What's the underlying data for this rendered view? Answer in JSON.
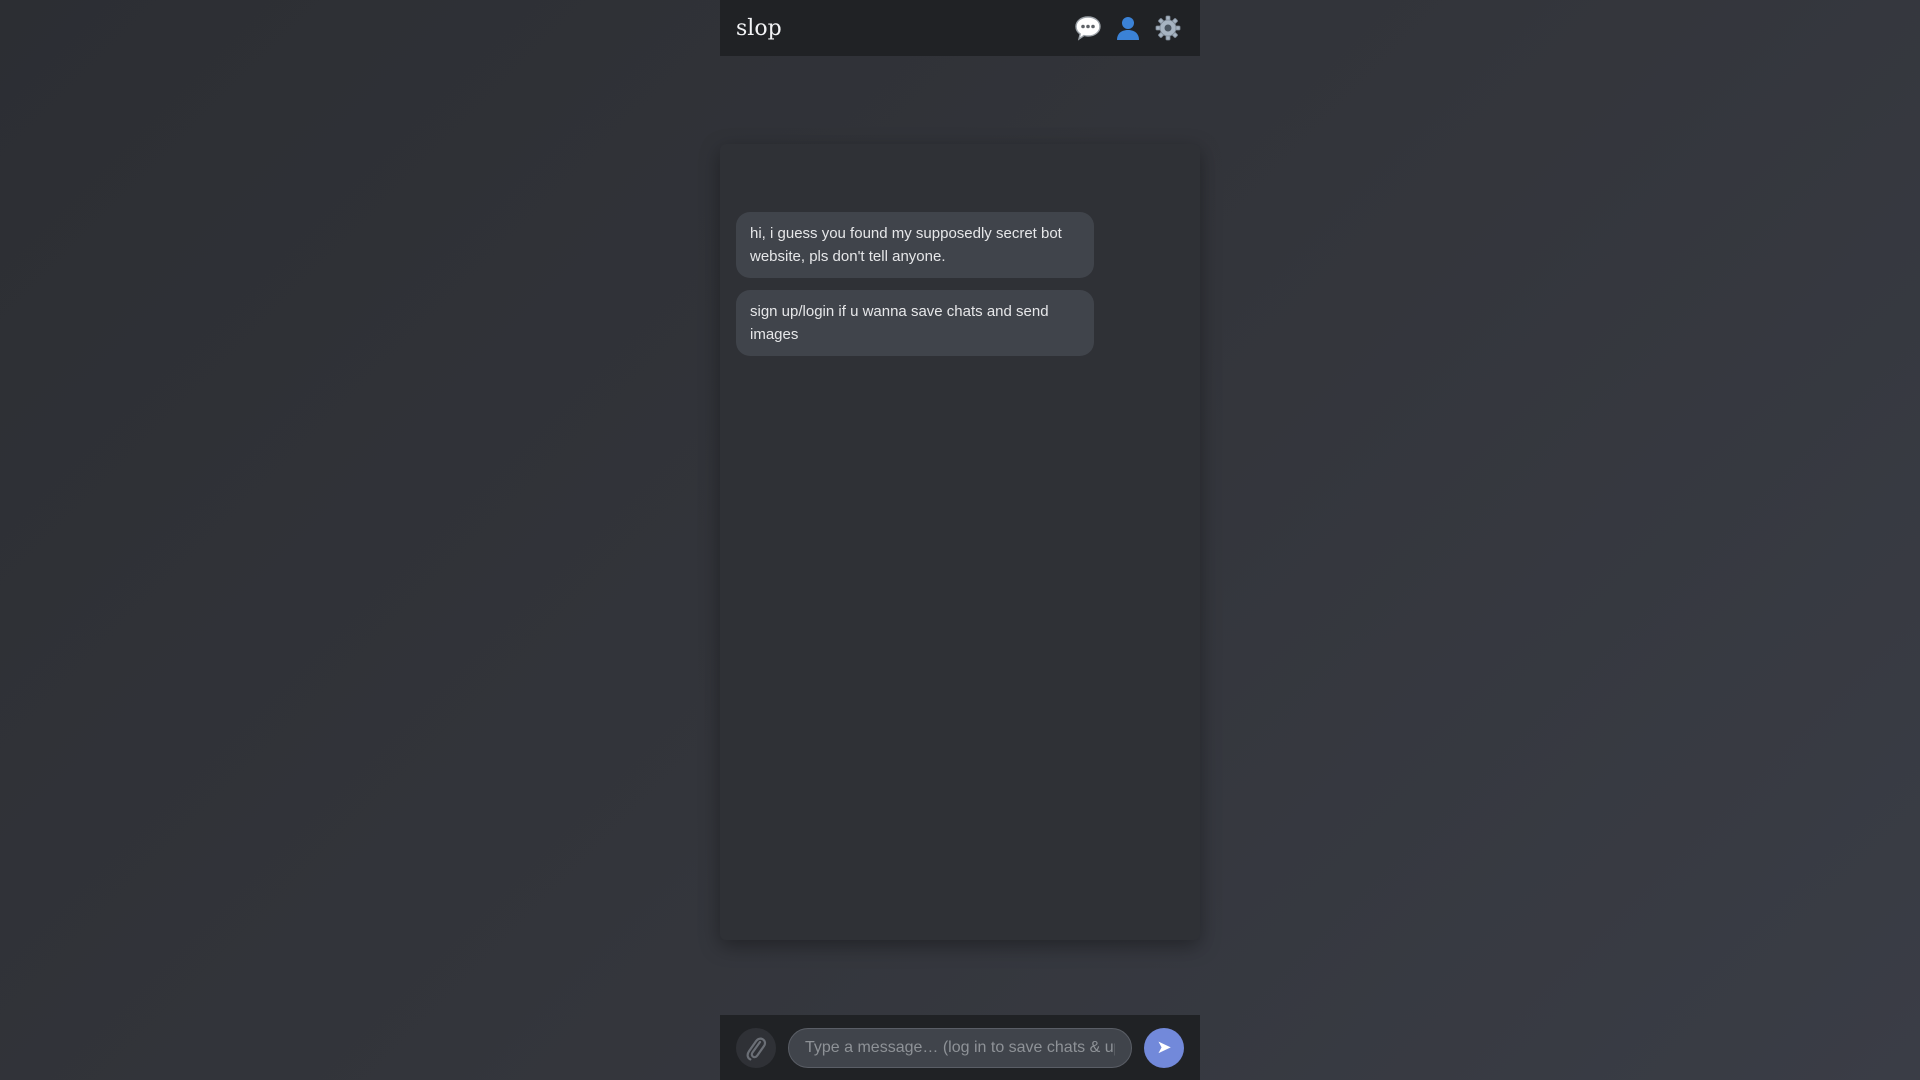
{
  "header": {
    "brand": "slop",
    "icons": [
      "chat-bubble-icon",
      "user-icon",
      "gear-icon"
    ]
  },
  "messages": [
    {
      "text": "hi, i guess you found my supposedly secret bot website, pls don't tell anyone."
    },
    {
      "text": "sign up/login if u wanna save chats and send images"
    }
  ],
  "composer": {
    "placeholder": "Type a message… (log in to save chats & upload images)",
    "value": "",
    "attach_icon": "paperclip-icon",
    "send_icon": "send-arrow-icon",
    "send_glyph": "➤"
  },
  "colors": {
    "topbar": "#202225",
    "chat_bg": "#2f3136",
    "bubble": "#40444b",
    "accent": "#7289da"
  }
}
